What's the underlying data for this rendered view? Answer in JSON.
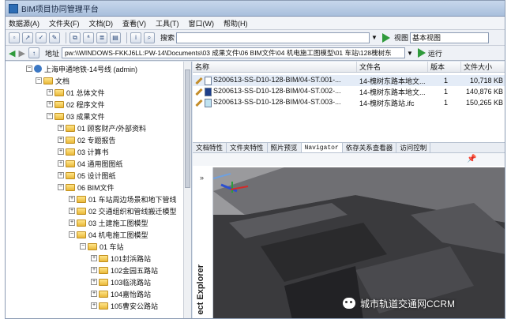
{
  "window": {
    "title": "BIM项目协同管理平台"
  },
  "menu": [
    "数据源(A)",
    "文件夹(F)",
    "文档(D)",
    "查看(V)",
    "工具(T)",
    "窗口(W)",
    "帮助(H)"
  ],
  "toolbar": {
    "search_label": "搜索",
    "search_value": "",
    "view_label": "视图",
    "view_value": "基本视图"
  },
  "address": {
    "label": "地址",
    "value": "pw:\\\\WINDOWS-FKKJ6LL:PW-14\\Documents\\03 成果文件\\06 BIM文件\\04 机电施工图模型\\01 车站\\128槐树东",
    "run_label": "运行"
  },
  "tree": {
    "root": "上海申通地铁-14号线 (admin)",
    "items": [
      "文档",
      "01 总体文件",
      "02 程序文件",
      "03 成果文件",
      "01 顾客财产/外部资料",
      "02 专题报告",
      "03 计算书",
      "04 通用图图纸",
      "05 设计图纸",
      "06 BIM文件",
      "01 车站周边场景和地下管线",
      "02 交通组织和管线搬迁模型",
      "03 土建施工图模型",
      "04 机电施工图模型",
      "01 车站",
      "101封浜路站",
      "102金园五路站",
      "103临洮路站",
      "104嘉怡路站",
      "105曹安公路站"
    ]
  },
  "documents": {
    "columns": [
      "名称",
      "文件名",
      "版本",
      "文件大小"
    ],
    "rows": [
      {
        "name": "S200613-SS-D10-128-BIM/04-ST.001-...",
        "file": "14-槐树东路本地文...",
        "version": "1",
        "size": "10,718 KB"
      },
      {
        "name": "S200613-SS-D10-128-BIM/04-ST.002-...",
        "file": "14-槐树东路本地文...",
        "version": "1",
        "size": "140,876 KB"
      },
      {
        "name": "S200613-SS-D10-128-BIM/04-ST.003-...",
        "file": "14-槐树东路站.ifc",
        "version": "1",
        "size": "150,265 KB"
      }
    ]
  },
  "tabs": [
    "文档特性",
    "文件夹特性",
    "照片预览",
    "Navigator",
    "依存关系查看器",
    "访问控制"
  ],
  "panel": {
    "side_label": "ect Explorer"
  },
  "watermark": {
    "text": "城市轨道交通网CCRM"
  }
}
